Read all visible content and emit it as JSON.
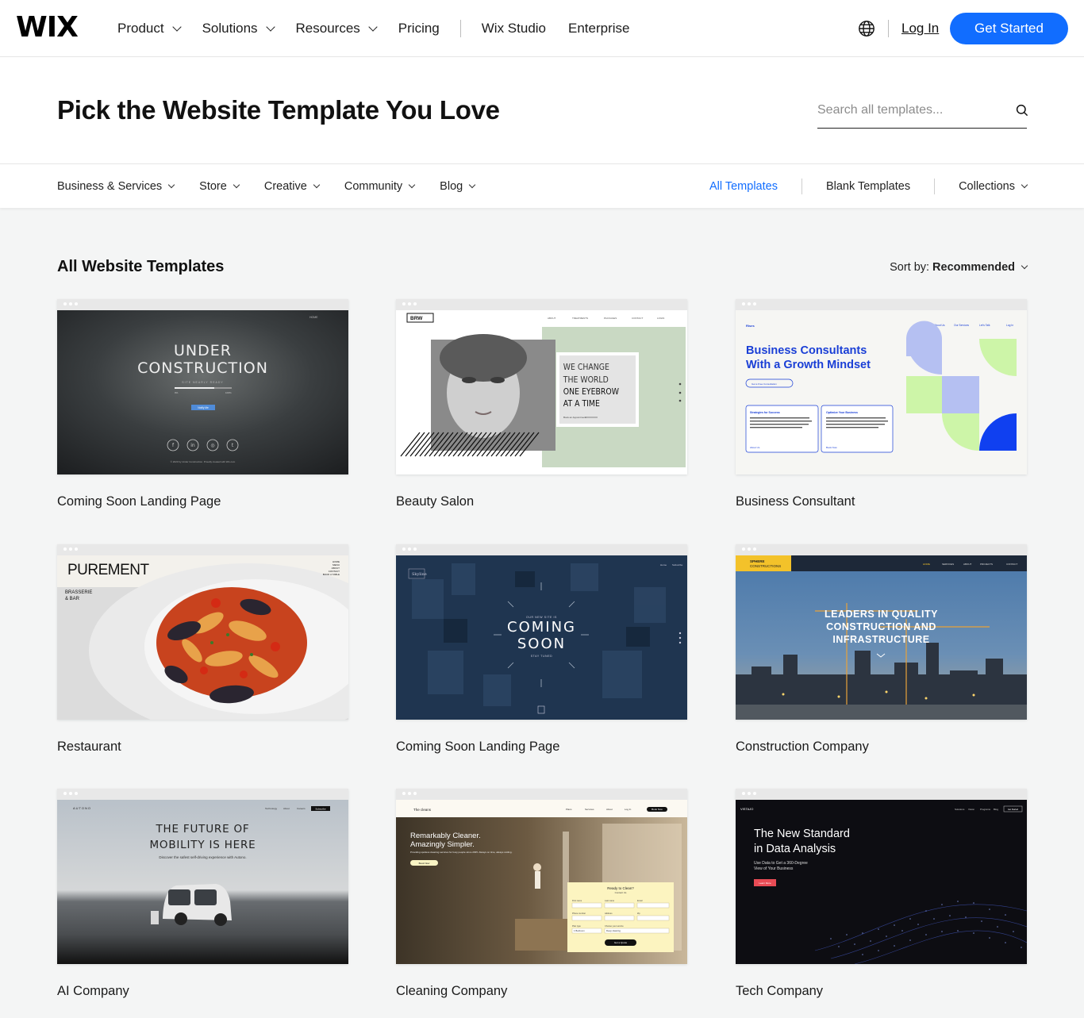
{
  "header": {
    "logo": "WIX",
    "nav": [
      {
        "label": "Product",
        "dropdown": true
      },
      {
        "label": "Solutions",
        "dropdown": true
      },
      {
        "label": "Resources",
        "dropdown": true
      },
      {
        "label": "Pricing",
        "dropdown": false
      },
      {
        "label": "Wix Studio",
        "dropdown": false
      },
      {
        "label": "Enterprise",
        "dropdown": false
      }
    ],
    "globe_icon": "globe-icon",
    "login": "Log In",
    "cta": "Get Started",
    "cta_color": "#116dff"
  },
  "hero": {
    "title": "Pick the Website Template You Love",
    "search_placeholder": "Search all templates...",
    "search_icon": "search-icon"
  },
  "categories": {
    "left": [
      "Business & Services",
      "Store",
      "Creative",
      "Community",
      "Blog"
    ],
    "all_templates": "All Templates",
    "blank_templates": "Blank Templates",
    "collections": "Collections",
    "active_color": "#116dff"
  },
  "listing": {
    "title": "All Website Templates",
    "sort_label": "Sort by:",
    "sort_value": "Recommended"
  },
  "templates": [
    {
      "name": "Coming Soon Landing Page",
      "preview": {
        "heading_1": "UNDER",
        "heading_2": "CONSTRUCTION",
        "nav": "HOME",
        "sub": "SITE NEARLY READY",
        "pct_left": "0%",
        "pct_right": "100%",
        "button": "Notify Me",
        "footer": "© 2023 by Under Construction. Proudly created with Wix.com"
      }
    },
    {
      "name": "Beauty Salon",
      "preview": {
        "logo": "BRW",
        "nav": [
          "ABOUT",
          "TREATMENTS",
          "PACKAGES",
          "CONTACT",
          "LOGIN"
        ],
        "line_1": "WE CHANGE",
        "line_2": "THE WORLD",
        "line_3": "ONE EYEBROW",
        "line_4": "AT A TIME",
        "link": "Book an Appointment"
      }
    },
    {
      "name": "Business Consultant",
      "preview": {
        "brand": "Rises",
        "nav": [
          "About Us",
          "Our Services",
          "Let's Talk",
          "Log In"
        ],
        "title_1": "Business Consultants",
        "title_2": "With a Growth Mindset",
        "cta": "Get a Free Consultation",
        "box1_title": "Strategies for Success",
        "box1_link": "About Us",
        "box2_title": "Optimize Your Business",
        "box2_link": "Book Now",
        "body": "I'm a paragraph. Click here to add your own text and edit me. I'm a great place for you to tell a story and let your users know a little more about you."
      }
    },
    {
      "name": "Restaurant",
      "preview": {
        "brand": "PUREMENT",
        "subtitle_1": "BRASSERIE",
        "subtitle_2": "& BAR",
        "nav": [
          "HOME",
          "MENU",
          "ABOUT",
          "CONTACT",
          "BOOK A TABLE"
        ]
      }
    },
    {
      "name": "Coming Soon Landing Page",
      "preview": {
        "brand": "Skyline",
        "nav": [
          "Home",
          "Subscribe"
        ],
        "small": "OUR NEW SITE IS",
        "line_1": "COMING",
        "line_2": "SOON",
        "tag": "STAY TUNED"
      }
    },
    {
      "name": "Construction Company",
      "preview": {
        "brand_1": "SPHERE",
        "brand_2": "CONSTRUCTIONS",
        "nav": [
          "HOME",
          "SERVICES",
          "ABOUT",
          "PROJECTS",
          "CONTACT"
        ],
        "line_1": "LEADERS IN QUALITY",
        "line_2": "CONSTRUCTION AND",
        "line_3": "INFRASTRUCTURE"
      }
    },
    {
      "name": "AI Company",
      "preview": {
        "brand": "AUTONO",
        "nav": [
          "Technology",
          "About",
          "Careers"
        ],
        "button": "Subscribe",
        "line_1": "THE FUTURE OF",
        "line_2": "MOBILITY IS HERE",
        "sub": "Discover the safest self-driving experience with Autono."
      }
    },
    {
      "name": "Cleaning Company",
      "preview": {
        "brand": "The cleans",
        "nav": [
          "Plans",
          "Services",
          "About",
          "Log In"
        ],
        "button": "Book Now",
        "line_1": "Remarkably Cleaner.",
        "line_2": "Amazingly Simpler.",
        "sub": "Providing spotless cleaning services for busy people since 2035. Always on time, always smiling.",
        "cta": "Book Now",
        "form_title": "Ready to Clean?",
        "form_sub": "Contact Us",
        "form_fields": [
          "First name",
          "Last name",
          "Email",
          "Phone number",
          "Address",
          "Zip",
          "Plan type",
          "Choose your service"
        ],
        "form_values": [
          "1 Bedroom",
          "Deep cleaning"
        ],
        "form_button": "Get a Quote"
      }
    },
    {
      "name": "Tech Company",
      "preview": {
        "brand": "VISTAJO",
        "nav": [
          "Solutions",
          "Vision",
          "Programs",
          "Blog"
        ],
        "button": "Get Started",
        "line_1": "The New Standard",
        "line_2": "in Data Analysis",
        "sub_1": "Use Data to Get a 360-Degree",
        "sub_2": "View of Your Business",
        "cta": "Learn More"
      }
    }
  ]
}
